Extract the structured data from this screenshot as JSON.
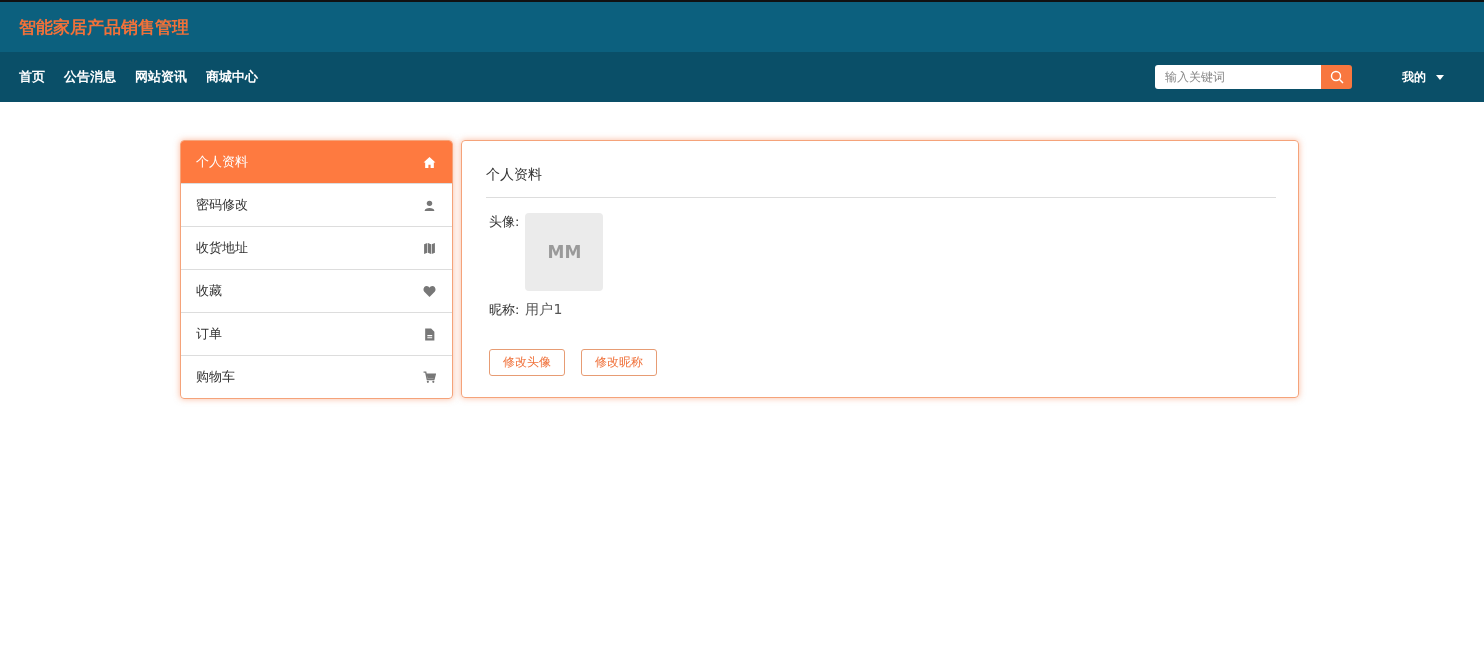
{
  "site_title": "智能家居产品销售管理",
  "nav": [
    {
      "label": "首页"
    },
    {
      "label": "公告消息"
    },
    {
      "label": "网站资讯"
    },
    {
      "label": "商城中心"
    }
  ],
  "search": {
    "placeholder": "输入关键词"
  },
  "user_menu": {
    "label": "我的"
  },
  "sidebar": {
    "items": [
      {
        "label": "个人资料",
        "selected": true
      },
      {
        "label": "密码修改",
        "selected": false
      },
      {
        "label": "收货地址",
        "selected": false
      },
      {
        "label": "收藏",
        "selected": false
      },
      {
        "label": "订单",
        "selected": false
      },
      {
        "label": "购物车",
        "selected": false
      }
    ]
  },
  "panel": {
    "title": "个人资料",
    "avatar_label": "头像:",
    "avatar_text": "MM",
    "nickname_label": "昵称:",
    "nickname": "用户1",
    "buttons": [
      {
        "label": "修改头像"
      },
      {
        "label": "修改昵称"
      }
    ]
  }
}
